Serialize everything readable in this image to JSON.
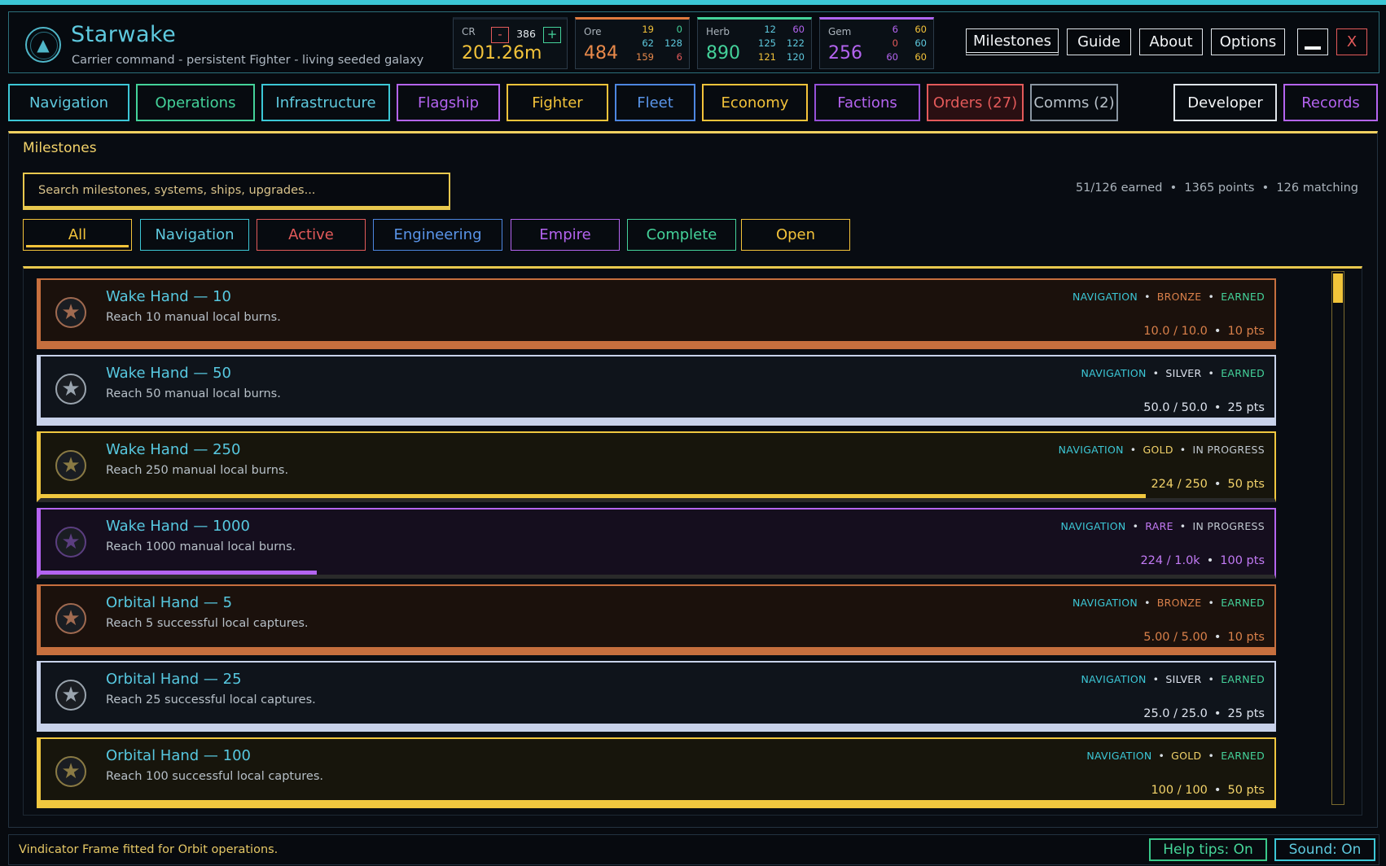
{
  "app": {
    "title": "Starwake",
    "subtitle": "Carrier command - persistent Fighter - living seeded galaxy",
    "logo_icon": "carrier-emblem-icon"
  },
  "resources": {
    "cr": {
      "label": "CR",
      "value": "201.26m",
      "stepper": "386",
      "minus": "-",
      "plus": "+"
    },
    "ore": {
      "label": "Ore",
      "value": "484",
      "grid": [
        "19",
        "0",
        "62",
        "128",
        "159",
        "6"
      ]
    },
    "herb": {
      "label": "Herb",
      "value": "890",
      "grid": [
        "12",
        "60",
        "125",
        "122",
        "121",
        "120"
      ]
    },
    "gem": {
      "label": "Gem",
      "value": "256",
      "grid": [
        "6",
        "60",
        "0",
        "60",
        "60",
        "60"
      ]
    }
  },
  "top_buttons": {
    "milestones": "Milestones",
    "guide": "Guide",
    "about": "About",
    "options": "Options",
    "minimize": "",
    "close": "X"
  },
  "tabs": [
    "Navigation",
    "Operations",
    "Infrastructure",
    "Flagship",
    "Fighter",
    "Fleet",
    "Economy",
    "Factions",
    "Orders (27)",
    "Comms (2)",
    "Developer",
    "Records"
  ],
  "panel": {
    "title": "Milestones",
    "search_placeholder": "Search milestones, systems, ships, upgrades...",
    "stats": "51/126 earned  •  1365 points  •  126 matching",
    "filters": [
      "All",
      "Navigation",
      "Active",
      "Engineering",
      "Empire",
      "Complete",
      "Open"
    ]
  },
  "milestones": [
    {
      "name": "Wake Hand — 10",
      "desc": "Reach 10 manual local burns.",
      "category": "NAVIGATION",
      "tier": "BRONZE",
      "status": "EARNED",
      "progress_text": "10.0 / 10.0",
      "points": "10 pts",
      "progress": 1.0
    },
    {
      "name": "Wake Hand — 50",
      "desc": "Reach 50 manual local burns.",
      "category": "NAVIGATION",
      "tier": "SILVER",
      "status": "EARNED",
      "progress_text": "50.0 / 50.0",
      "points": "25 pts",
      "progress": 1.0
    },
    {
      "name": "Wake Hand — 250",
      "desc": "Reach 250 manual local burns.",
      "category": "NAVIGATION",
      "tier": "GOLD",
      "status": "IN PROGRESS",
      "progress_text": "224 / 250",
      "points": "50 pts",
      "progress": 0.896
    },
    {
      "name": "Wake Hand — 1000",
      "desc": "Reach 1000 manual local burns.",
      "category": "NAVIGATION",
      "tier": "RARE",
      "status": "IN PROGRESS",
      "progress_text": "224 / 1.0k",
      "points": "100 pts",
      "progress": 0.224
    },
    {
      "name": "Orbital Hand — 5",
      "desc": "Reach 5 successful local captures.",
      "category": "NAVIGATION",
      "tier": "BRONZE",
      "status": "EARNED",
      "progress_text": "5.00 / 5.00",
      "points": "10 pts",
      "progress": 1.0
    },
    {
      "name": "Orbital Hand — 25",
      "desc": "Reach 25 successful local captures.",
      "category": "NAVIGATION",
      "tier": "SILVER",
      "status": "EARNED",
      "progress_text": "25.0 / 25.0",
      "points": "25 pts",
      "progress": 1.0
    },
    {
      "name": "Orbital Hand — 100",
      "desc": "Reach 100 successful local captures.",
      "category": "NAVIGATION",
      "tier": "GOLD",
      "status": "EARNED",
      "progress_text": "100 / 100",
      "points": "50 pts",
      "progress": 1.0
    }
  ],
  "footer": {
    "message": "Vindicator Frame fitted for Orbit operations.",
    "help": "Help tips: On",
    "sound": "Sound: On"
  },
  "colors": {
    "cyan": "#3cc7d6",
    "gold": "#f3c33a",
    "bronze": "#d9804a",
    "silver": "#c8d2ea",
    "rare": "#b464f0",
    "green": "#44d29a",
    "red": "#e35a5a"
  }
}
